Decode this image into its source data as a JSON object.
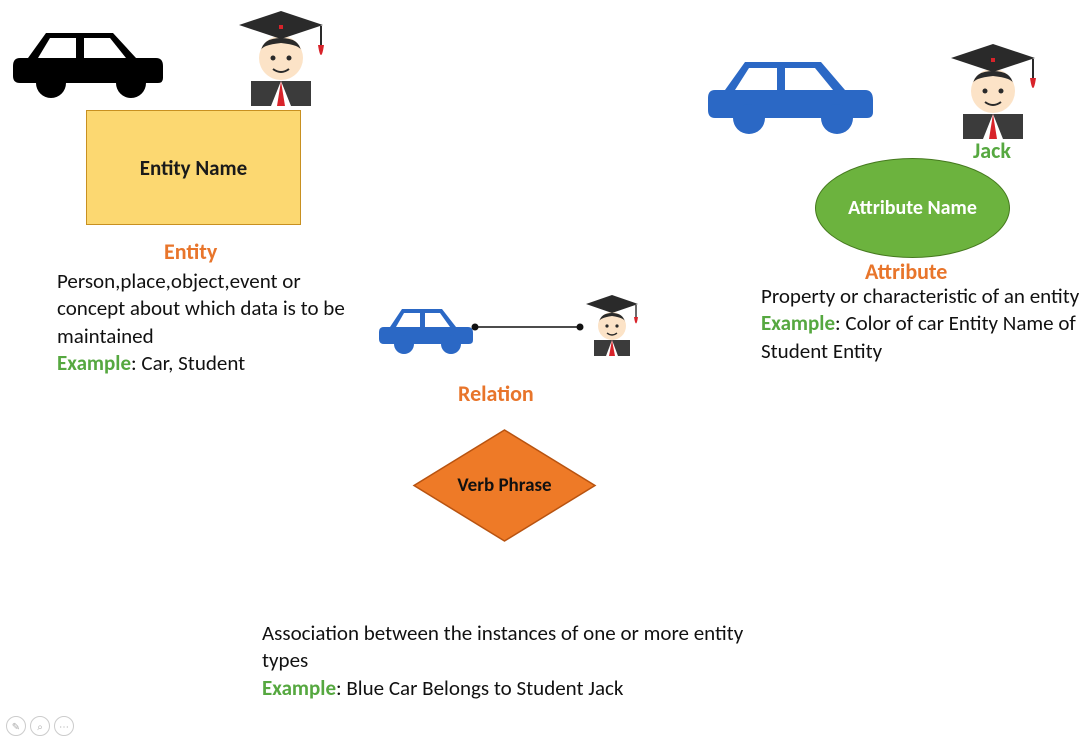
{
  "entity": {
    "box_label": "Entity Name",
    "title": "Entity",
    "description": "Person,place,object,event or concept about which data is to be maintained",
    "example_label": "Example",
    "example_text": ": Car, Student"
  },
  "attribute": {
    "student_name": "Jack",
    "ellipse_label": "Attribute Name",
    "title": "Attribute",
    "description": "Property or characteristic of an entity",
    "example_label": "Example",
    "example_text": ": Color of car Entity Name of Student Entity"
  },
  "relation": {
    "title": "Relation",
    "diamond_label": "Verb Phrase",
    "description": "Association between the instances of one or more entity types",
    "example_label": "Example",
    "example_text": ": Blue Car Belongs to Student Jack"
  }
}
